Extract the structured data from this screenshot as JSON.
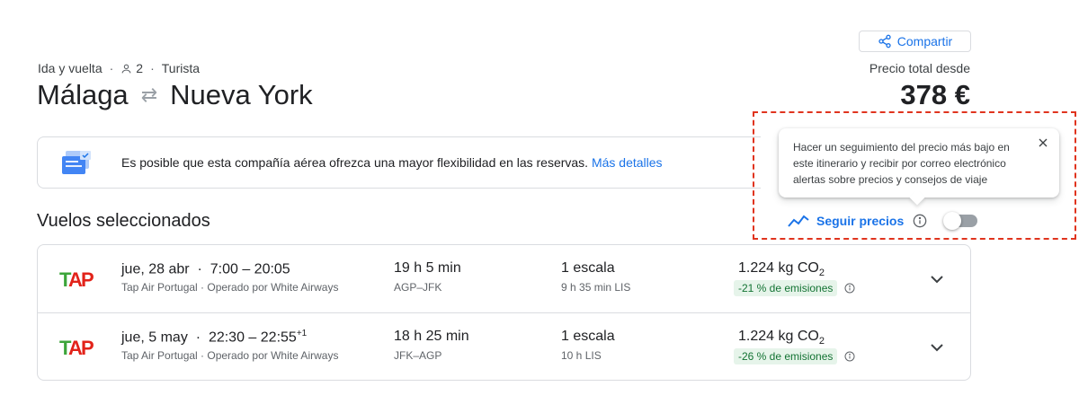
{
  "share": {
    "label": "Compartir"
  },
  "trip": {
    "type": "Ida y vuelta",
    "passengers": "2",
    "cabin": "Turista",
    "origin": "Málaga",
    "destination": "Nueva York",
    "price_label": "Precio total desde",
    "price": "378 €"
  },
  "banner": {
    "text": "Es posible que esta compañía aérea ofrezca una mayor flexibilidad en las reservas.",
    "link": "Más detalles"
  },
  "section_title": "Vuelos seleccionados",
  "flights": [
    {
      "date": "jue, 28 abr",
      "times": "7:00 – 20:05",
      "day_offset": "",
      "airline": "Tap Air Portugal · Operado por White Airways",
      "duration": "19 h 5 min",
      "route": "AGP–JFK",
      "stops": "1 escala",
      "layover": "9 h 35 min LIS",
      "co2": "1.224 kg CO",
      "co2_sub": "2",
      "emissions": "-21 % de emisiones"
    },
    {
      "date": "jue, 5 may",
      "times": "22:30 – 22:55",
      "day_offset": "+1",
      "airline": "Tap Air Portugal · Operado por White Airways",
      "duration": "18 h 25 min",
      "route": "JFK–AGP",
      "stops": "1 escala",
      "layover": "10 h LIS",
      "co2": "1.224 kg CO",
      "co2_sub": "2",
      "emissions": "-26 % de emisiones"
    }
  ],
  "tracking": {
    "tooltip": "Hacer un seguimiento del precio más bajo en este itinerario y recibir por correo electrónico alertas sobre precios y consejos de viaje",
    "label": "Seguir precios",
    "enabled": false
  },
  "colors": {
    "accent": "#1a73e8",
    "badge_bg": "#e6f4ea",
    "badge_text": "#137333",
    "highlight": "#e0341e"
  },
  "icons": {
    "share": "share-icon",
    "person": "person-icon",
    "swap": "swap-arrows-icon",
    "trend": "trending-icon",
    "info": "info-icon",
    "close": "close-icon",
    "chevron": "chevron-down-icon"
  }
}
